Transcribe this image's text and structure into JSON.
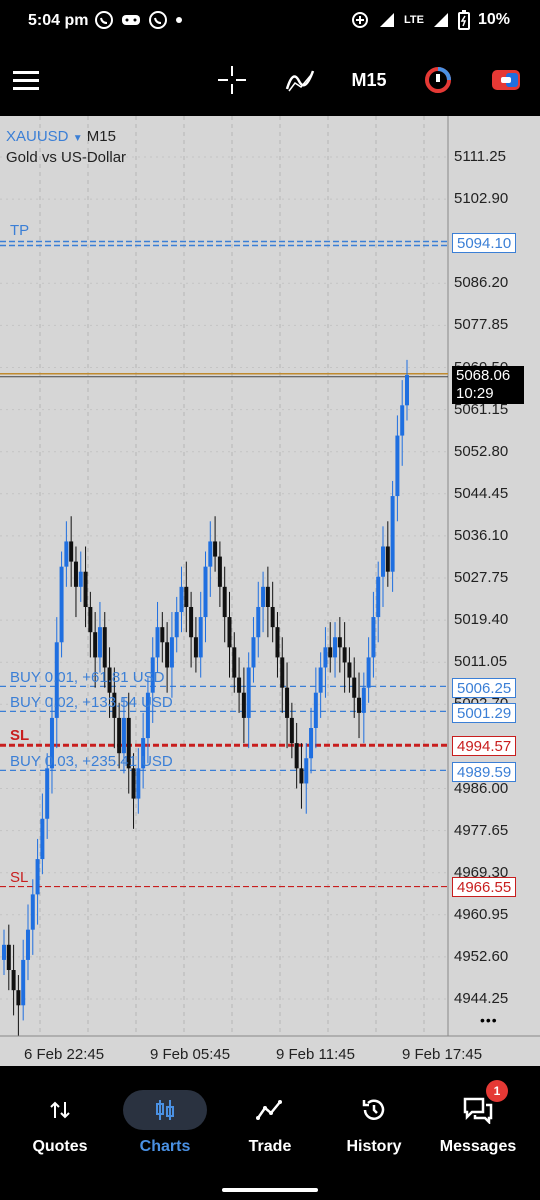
{
  "status": {
    "time": "5:04 pm",
    "network": "LTE",
    "battery": "10%"
  },
  "toolbar": {
    "timeframe": "M15"
  },
  "chart": {
    "symbol": "XAUUSD",
    "timeframe": "M15",
    "description": "Gold vs US-Dollar",
    "price_labels": [
      "5111.25",
      "5102.90",
      "5086.20",
      "5077.85",
      "5069.50",
      "5061.15",
      "5052.80",
      "5044.45",
      "5036.10",
      "5027.75",
      "5019.40",
      "5011.05",
      "5002.70",
      "4986.00",
      "4977.65",
      "4969.30",
      "4960.95",
      "4952.60",
      "4944.25"
    ],
    "current_price": "5068.06",
    "countdown": "10:29",
    "tp": {
      "label": "TP",
      "price": "5094.10"
    },
    "orders": [
      {
        "label": "BUY 0.01,   +61.81 USD",
        "price": "5006.25"
      },
      {
        "label": "BUY 0.02,   +133.54 USD",
        "price": "5001.29"
      },
      {
        "label": "BUY 0.03,   +235.41 USD",
        "price": "4989.59"
      }
    ],
    "sl1": {
      "label": "SL",
      "price": "4994.57"
    },
    "sl2": {
      "label": "SL",
      "price": "4966.55"
    },
    "time_labels": [
      "6 Feb 22:45",
      "9 Feb 05:45",
      "9 Feb 11:45",
      "9 Feb 17:45"
    ],
    "more": "•••"
  },
  "nav": {
    "items": [
      {
        "label": "Quotes"
      },
      {
        "label": "Charts"
      },
      {
        "label": "Trade"
      },
      {
        "label": "History"
      },
      {
        "label": "Messages"
      }
    ],
    "messages_badge": "1"
  },
  "colors": {
    "bull": "#1f6fe0",
    "bear": "#111111",
    "accent": "#4a90e2",
    "sl": "#c81e1e",
    "chart_bg": "#d6d6d6"
  }
}
